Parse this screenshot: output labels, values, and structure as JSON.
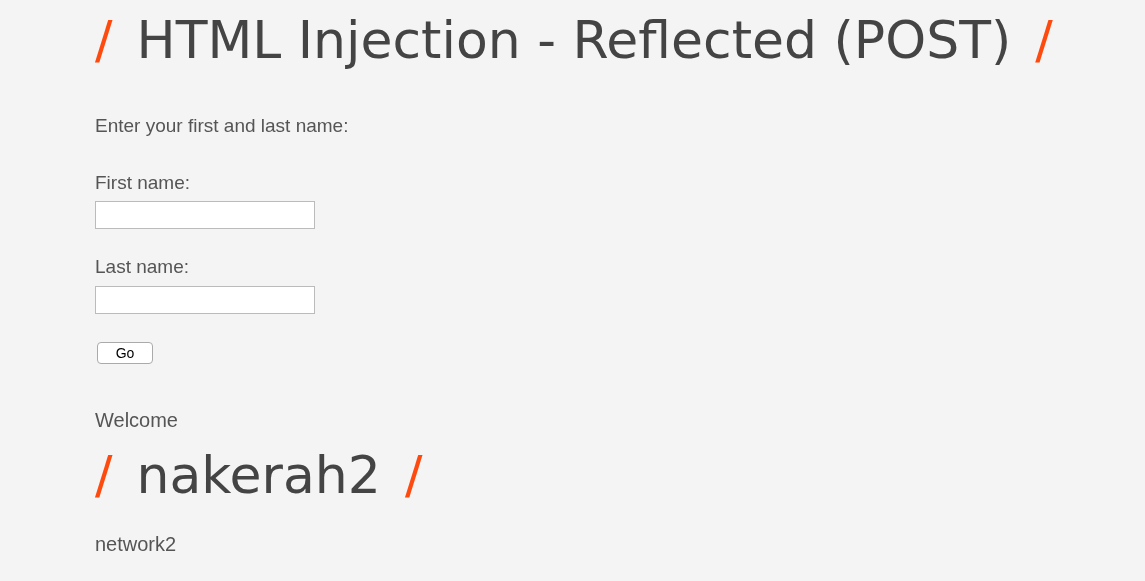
{
  "title": {
    "mark_left": "/",
    "text": "HTML Injection - Reflected (POST)",
    "mark_right": "/"
  },
  "intro": "Enter your first and last name:",
  "fields": [
    {
      "label": "First name:"
    },
    {
      "label": "Last name:"
    }
  ],
  "submit": "Go",
  "result": {
    "welcome": "Welcome",
    "heading": {
      "mark_left": "/",
      "text": "nakerah2",
      "mark_right": "/"
    },
    "after": "network2"
  }
}
